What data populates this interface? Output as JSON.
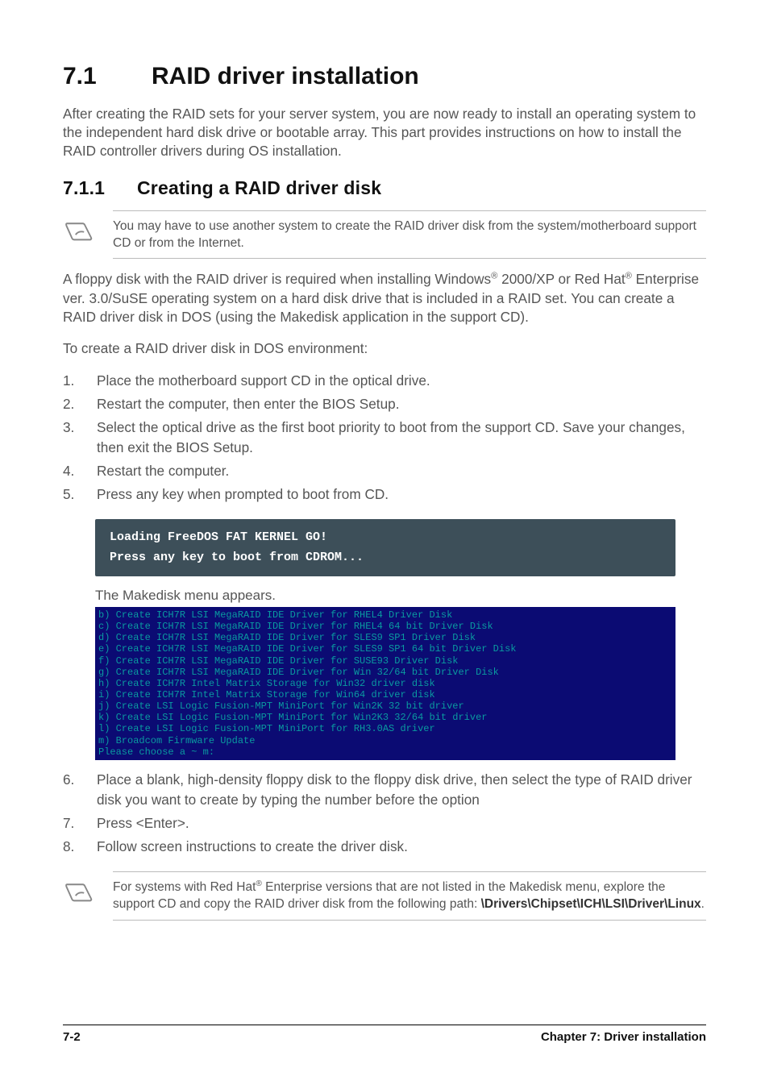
{
  "section": {
    "number": "7.1",
    "title": "RAID driver installation",
    "intro": "After creating the RAID sets for your server system, you are now ready to install an operating system to the independent hard disk drive or bootable array. This part provides instructions on how to install the RAID controller drivers during OS installation."
  },
  "sub": {
    "number": "7.1.1",
    "title": "Creating a RAID driver disk"
  },
  "note1": "You may have to use another system to create the RAID driver disk from the system/motherboard support CD or from the Internet.",
  "p1a": "A floppy disk with the RAID driver is required when installing Windows",
  "p1b": " 2000/XP or Red Hat",
  "p1c": " Enterprise ver. 3.0/SuSE operating system on a hard disk drive that is included in a RAID set. You can create a RAID driver disk in DOS (using the Makedisk application in the support CD).",
  "p2": "To create a RAID driver disk in DOS environment:",
  "steps1": [
    "Place the motherboard support CD in the optical drive.",
    "Restart the computer, then enter the BIOS Setup.",
    "Select the optical drive as the first boot priority to boot from the support CD. Save your changes, then exit the BIOS Setup.",
    "Restart the computer.",
    "Press any key when prompted to boot from CD."
  ],
  "term_dark": {
    "l1": "Loading FreeDOS FAT KERNEL GO!",
    "l2": "Press any key to boot from CDROM..."
  },
  "caption": "The Makedisk menu appears.",
  "term_blue": "b) Create ICH7R LSI MegaRAID IDE Driver for RHEL4 Driver Disk\nc) Create ICH7R LSI MegaRAID IDE Driver for RHEL4 64 bit Driver Disk\nd) Create ICH7R LSI MegaRAID IDE Driver for SLES9 SP1 Driver Disk\ne) Create ICH7R LSI MegaRAID IDE Driver for SLES9 SP1 64 bit Driver Disk\nf) Create ICH7R LSI MegaRAID IDE Driver for SUSE93 Driver Disk\ng) Create ICH7R LSI MegaRAID IDE Driver for Win 32/64 bit Driver Disk\nh) Create ICH7R Intel Matrix Storage for Win32 driver disk\ni) Create ICH7R Intel Matrix Storage for Win64 driver disk\nj) Create LSI Logic Fusion-MPT MiniPort for Win2K 32 bit driver\nk) Create LSI Logic Fusion-MPT MiniPort for Win2K3 32/64 bit driver\nl) Create LSI Logic Fusion-MPT MiniPort for RH3.0AS driver\nm) Broadcom Firmware Update\nPlease choose a ~ m:",
  "steps2": [
    {
      "n": "6.",
      "t": "Place a blank, high-density floppy disk to the floppy disk drive, then select the type of RAID driver disk you want to create by typing the number before the option"
    },
    {
      "n": "7.",
      "t": "Press <Enter>."
    },
    {
      "n": "8.",
      "t": "Follow screen instructions to create the driver disk."
    }
  ],
  "note2a": "For systems with Red Hat",
  "note2b": " Enterprise versions that are not listed in the Makedisk menu, explore the support CD and copy the RAID driver disk from the following path: ",
  "note2path": "\\Drivers\\Chipset\\ICH\\LSI\\Driver\\Linux",
  "footer": {
    "left": "7-2",
    "right": "Chapter 7: Driver installation"
  }
}
